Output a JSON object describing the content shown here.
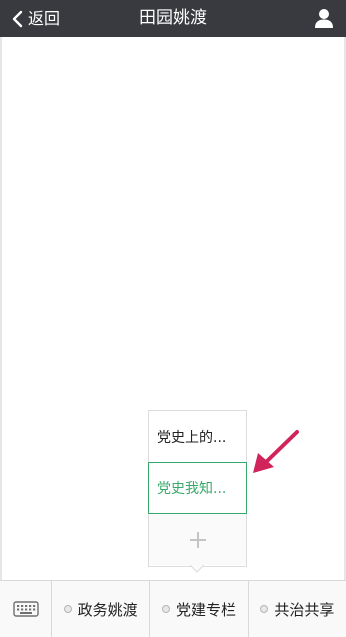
{
  "header": {
    "back_label": "返回",
    "title": "田园姚渡"
  },
  "submenu": {
    "items": [
      {
        "label": "党史上的..."
      },
      {
        "label": "党史我知..."
      }
    ],
    "add_label": "+"
  },
  "bottombar": {
    "tabs": [
      {
        "label": "政务姚渡"
      },
      {
        "label": "党建专栏"
      },
      {
        "label": "共治共享"
      }
    ]
  },
  "colors": {
    "header_bg": "#393a3f",
    "accent_green": "#39a96b",
    "annotation_arrow": "#d0245a"
  },
  "icons": [
    "chevron-left-icon",
    "user-icon",
    "keyboard-icon",
    "plus-icon",
    "dot-icon"
  ]
}
